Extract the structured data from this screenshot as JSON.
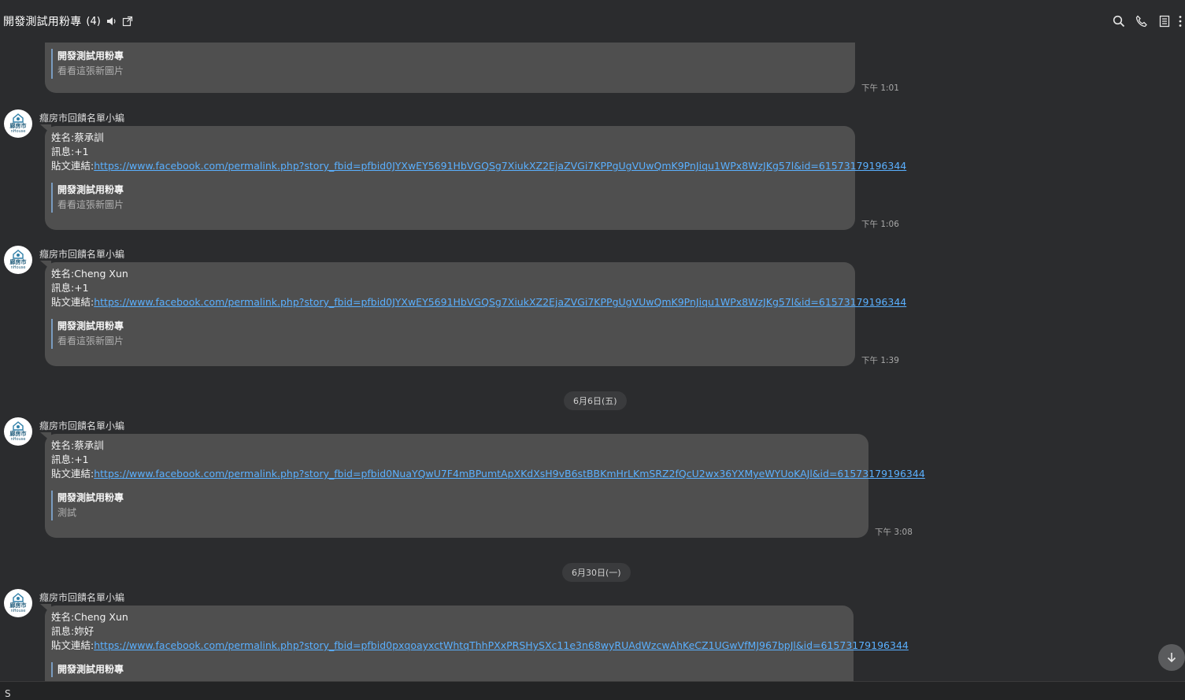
{
  "header": {
    "title": "開發測試用粉專",
    "count": "(4)",
    "icons": [
      "volume-icon",
      "popout-icon",
      "search-icon",
      "phone-icon",
      "notes-icon",
      "more-icon"
    ]
  },
  "avatar": {
    "line1": "廊房市",
    "line2": "nHouse"
  },
  "sender_name": "癮房市回饋名單小編",
  "messages": [
    {
      "partial": true,
      "quote_title": "開發測試用粉專",
      "quote_text": "看看這張新圖片",
      "time": "下午 1:01"
    },
    {
      "sender": "癮房市回饋名單小編",
      "name_line": "姓名:蔡承訓",
      "msg_line": "訊息:+1",
      "link_label": "貼文連結:",
      "link_url": "https://www.facebook.com/permalink.php?story_fbid=pfbid0JYXwEY5691HbVGQSg7XiukXZ2EjaZVGi7KPPgUgVUwQmK9PnJiqu1WPx8WzJKg57l&id=61573179196344",
      "quote_title": "開發測試用粉專",
      "quote_text": "看看這張新圖片",
      "time": "下午 1:06"
    },
    {
      "sender": "癮房市回饋名單小編",
      "name_line": "姓名:Cheng Xun",
      "msg_line": "訊息:+1",
      "link_label": "貼文連結:",
      "link_url": "https://www.facebook.com/permalink.php?story_fbid=pfbid0JYXwEY5691HbVGQSg7XiukXZ2EjaZVGi7KPPgUgVUwQmK9PnJiqu1WPx8WzJKg57l&id=61573179196344",
      "quote_title": "開發測試用粉專",
      "quote_text": "看看這張新圖片",
      "time": "下午 1:39"
    },
    {
      "sender": "癮房市回饋名單小編",
      "name_line": "姓名:蔡承訓",
      "msg_line": "訊息:+1",
      "link_label": "貼文連結:",
      "link_url": "https://www.facebook.com/permalink.php?story_fbid=pfbid0NuaYQwU7F4mBPumtApXKdXsH9vB6stBBKmHrLKmSRZ2fQcU2wx36YXMyeWYUoKAJl&id=61573179196344",
      "quote_title": "開發測試用粉專",
      "quote_text": "測試",
      "time": "下午 3:08"
    },
    {
      "sender": "癮房市回饋名單小編",
      "name_line": "姓名:Cheng Xun",
      "msg_line": "訊息:妳好",
      "link_label": "貼文連結:",
      "link_url": "https://www.facebook.com/permalink.php?story_fbid=pfbid0pxqoayxctWhtqThhPXxPRSHySXc11e3n68wyRUAdWzcwAhKeCZ1UGwVfMJ967bpJl&id=61573179196344",
      "quote_title": "開發測試用粉專"
    }
  ],
  "date_separators": [
    "6月6日(五)",
    "6月30日(一)"
  ],
  "input": {
    "value": "S"
  }
}
